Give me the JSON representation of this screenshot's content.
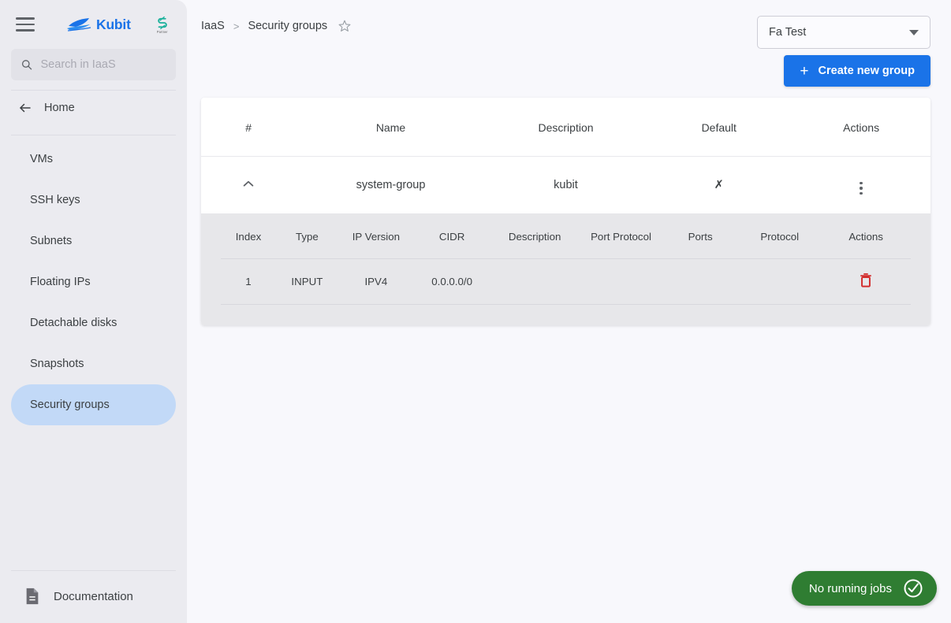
{
  "sidebar": {
    "brand": {
      "name": "Kubit",
      "logo_icon": "boat-logo-icon",
      "partner_logo_icon": "partner-s-logo-icon",
      "partner_sub": "Partner"
    },
    "menu_icon": "hamburger-menu-icon",
    "search": {
      "placeholder": "Search in IaaS",
      "value": "",
      "icon": "search-icon"
    },
    "home": {
      "label": "Home",
      "icon": "arrow-left-icon"
    },
    "items": [
      {
        "label": "VMs",
        "active": false
      },
      {
        "label": "SSH keys",
        "active": false
      },
      {
        "label": "Subnets",
        "active": false
      },
      {
        "label": "Floating IPs",
        "active": false
      },
      {
        "label": "Detachable disks",
        "active": false
      },
      {
        "label": "Snapshots",
        "active": false
      },
      {
        "label": "Security groups",
        "active": true
      }
    ],
    "footer": {
      "label": "Documentation",
      "icon": "document-icon"
    }
  },
  "header": {
    "breadcrumb": {
      "root": "IaaS",
      "separator": ">",
      "current": "Security groups",
      "favorite_icon": "star-outline-icon"
    },
    "project_select": {
      "value": "Fa Test",
      "caret_icon": "chevron-down-icon"
    },
    "create_button": {
      "label": "Create new group",
      "icon": "plus-icon"
    }
  },
  "table": {
    "columns": [
      "#",
      "Name",
      "Description",
      "Default",
      "Actions"
    ],
    "rows": [
      {
        "expand_icon": "chevron-up-icon",
        "name": "system-group",
        "description": "kubit",
        "default": "✗",
        "actions_icon": "kebab-menu-icon"
      }
    ]
  },
  "subtable": {
    "columns": [
      "Index",
      "Type",
      "IP Version",
      "CIDR",
      "Description",
      "Port Protocol",
      "Ports",
      "Protocol",
      "Actions"
    ],
    "rows": [
      {
        "index": "1",
        "type": "INPUT",
        "ip_version": "IPV4",
        "cidr": "0.0.0.0/0",
        "description": "",
        "port_protocol": "",
        "ports": "",
        "protocol": "",
        "delete_icon": "trash-icon"
      }
    ]
  },
  "status": {
    "jobs_label": "No running jobs",
    "icon": "check-circle-icon"
  },
  "colors": {
    "accent": "#1a73e8",
    "sidebar_bg": "#ebebf0",
    "content_bg": "#f8f8fc",
    "active_item": "#c2d9f7",
    "success": "#2f7d32",
    "danger": "#d32f2f",
    "subpanel_bg": "#e7e7ea"
  }
}
